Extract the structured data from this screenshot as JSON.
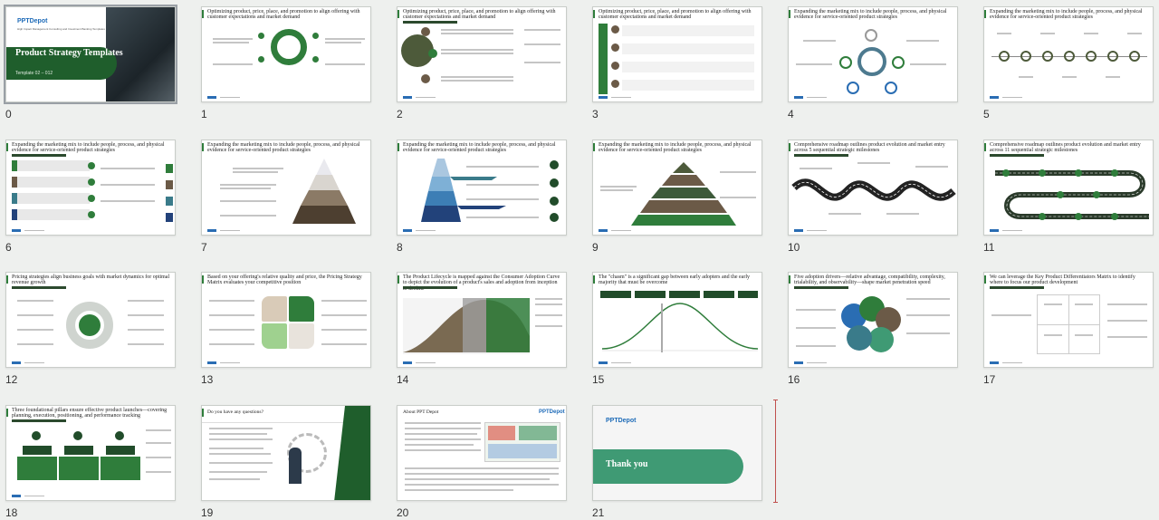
{
  "slides": [
    {
      "number": "0",
      "title": "Product Strategy Templates",
      "subtitle": "Template 02 – 012",
      "logo": "PPTDepot",
      "tagline": "High Impact Management Consulting and Investment Banking Templates"
    },
    {
      "number": "1",
      "title": "Optimizing product, price, place, and promotion to align offering with customer expectations and market demand"
    },
    {
      "number": "2",
      "title": "Optimizing product, price, place, and promotion to align offering with customer expectations and market demand"
    },
    {
      "number": "3",
      "title": "Optimizing product, price, place, and promotion to align offering with customer expectations and market demand"
    },
    {
      "number": "4",
      "title": "Expanding the marketing mix to include people, process, and physical evidence for service-oriented product strategies"
    },
    {
      "number": "5",
      "title": "Expanding the marketing mix to include people, process, and physical evidence for service-oriented product strategies"
    },
    {
      "number": "6",
      "title": "Expanding the marketing mix to include people, process, and physical evidence for service-oriented product strategies"
    },
    {
      "number": "7",
      "title": "Expanding the marketing mix to include people, process, and physical evidence for service-oriented product strategies"
    },
    {
      "number": "8",
      "title": "Expanding the marketing mix to include people, process, and physical evidence for service-oriented product strategies"
    },
    {
      "number": "9",
      "title": "Expanding the marketing mix to include people, process, and physical evidence for service-oriented product strategies"
    },
    {
      "number": "10",
      "title": "Comprehensive roadmap outlines product evolution and market entry across 5 sequential strategic milestones"
    },
    {
      "number": "11",
      "title": "Comprehensive roadmap outlines product evolution and market entry across 11 sequential strategic milestones"
    },
    {
      "number": "12",
      "title": "Pricing strategies align business goals with market dynamics for optimal revenue growth"
    },
    {
      "number": "13",
      "title": "Based on your offering's relative quality and price, the Pricing Strategy Matrix evaluates your competitive position"
    },
    {
      "number": "14",
      "title": "The Product Lifecycle is mapped against the Consumer Adoption Curve to depict the evolution of a product's sales and adoption from inception to decline"
    },
    {
      "number": "15",
      "title": "The \"chasm\" is a significant gap between early adopters and the early majority that must be overcome"
    },
    {
      "number": "16",
      "title": "Five adoption drivers—relative advantage, compatibility, complexity, trialability, and observability—shape market penetration speed"
    },
    {
      "number": "17",
      "title": "We can leverage the Key Product Differentiators Matrix to identify where to focus our product development"
    },
    {
      "number": "18",
      "title": "Three foundational pillars ensure effective product launches—covering planning, execution, positioning, and performance tracking"
    },
    {
      "number": "19",
      "title": "Do you have any questions?"
    },
    {
      "number": "20",
      "title": "About PPT Depot",
      "logo": "PPTDepot"
    },
    {
      "number": "21",
      "title": "Thank you",
      "logo": "PPTDepot"
    }
  ],
  "colors": {
    "accent": "#2f7d3b",
    "dark": "#214c2a",
    "brown": "#6b5a47",
    "marker": "#c0504d"
  }
}
